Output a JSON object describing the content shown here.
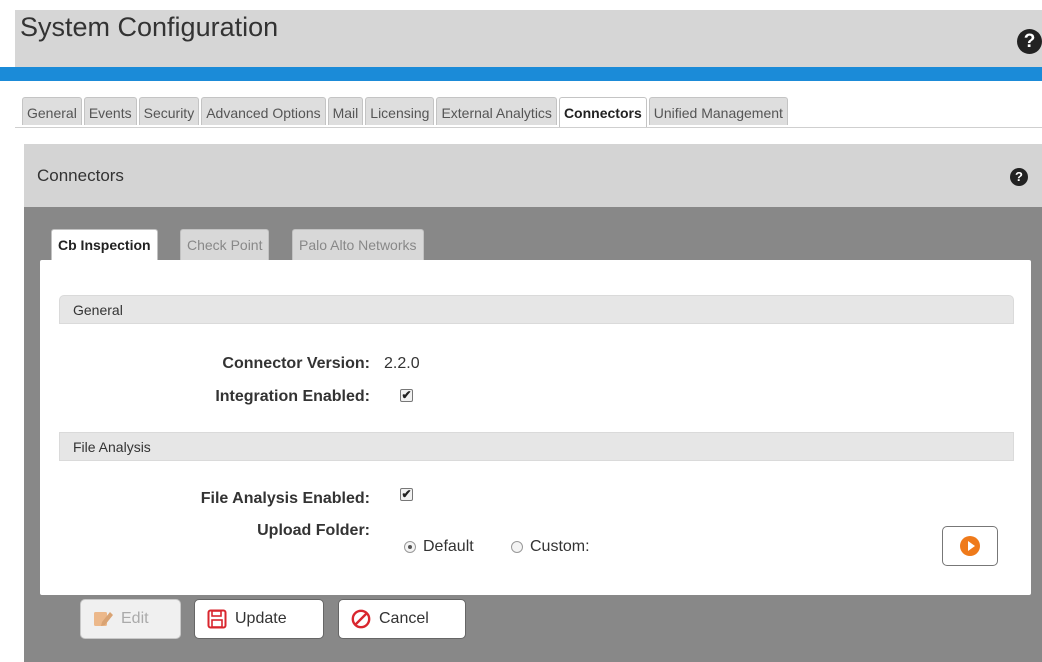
{
  "header": {
    "title": "System Configuration",
    "help_icon": "question-circle-icon"
  },
  "top_tabs": [
    {
      "label": "General",
      "active": false
    },
    {
      "label": "Events",
      "active": false
    },
    {
      "label": "Security",
      "active": false
    },
    {
      "label": "Advanced Options",
      "active": false
    },
    {
      "label": "Mail",
      "active": false
    },
    {
      "label": "Licensing",
      "active": false
    },
    {
      "label": "External Analytics",
      "active": false
    },
    {
      "label": "Connectors",
      "active": true
    },
    {
      "label": "Unified Management",
      "active": false
    }
  ],
  "panel": {
    "title": "Connectors",
    "tabs": [
      {
        "label": "Cb Inspection",
        "active": true
      },
      {
        "label": "Check Point",
        "active": false
      },
      {
        "label": "Palo Alto Networks",
        "active": false
      }
    ]
  },
  "general": {
    "heading": "General",
    "connector_version_label": "Connector Version:",
    "connector_version_value": "2.2.0",
    "integration_enabled_label": "Integration Enabled:",
    "integration_enabled": true
  },
  "file_analysis": {
    "heading": "File Analysis",
    "enabled_label": "File Analysis Enabled:",
    "enabled": true,
    "upload_folder_label": "Upload Folder:",
    "options": [
      {
        "label": "Default",
        "selected": true
      },
      {
        "label": "Custom:",
        "selected": false
      }
    ]
  },
  "buttons": {
    "edit": "Edit",
    "update": "Update",
    "cancel": "Cancel"
  },
  "colors": {
    "accent_bar": "#1b8bd8",
    "run_button": "#ef7a1a",
    "cancel_red": "#d9262e"
  }
}
